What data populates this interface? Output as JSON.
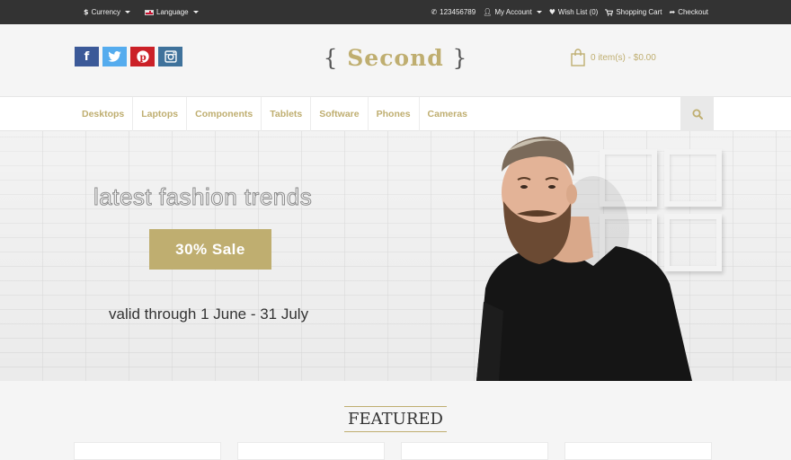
{
  "topbar": {
    "currency_label": "Currency",
    "language_label": "Language",
    "phone": "123456789",
    "my_account": "My Account",
    "wishlist": "Wish List (0)",
    "shopping_cart": "Shopping Cart",
    "checkout": "Checkout"
  },
  "header": {
    "logo_text": "Second",
    "logo_left_brace": "{",
    "logo_right_brace": "}",
    "cart_summary": "0 item(s) - $0.00",
    "social": [
      "facebook-icon",
      "twitter-icon",
      "pinterest-icon",
      "instagram-icon"
    ]
  },
  "nav": {
    "items": [
      "Desktops",
      "Laptops",
      "Components",
      "Tablets",
      "Software",
      "Phones",
      "Cameras"
    ]
  },
  "banner": {
    "headline": "latest fashion trends",
    "sale_button": "30% Sale",
    "validity": "valid through 1 June - 31 July"
  },
  "featured": {
    "title": "FEATURED"
  },
  "colors": {
    "accent": "#bfae70",
    "topbar_bg": "#333333",
    "page_bg": "#f5f5f5",
    "facebook": "#3b5998",
    "twitter": "#55acee",
    "pinterest": "#cb2027",
    "instagram": "#3f729b"
  }
}
